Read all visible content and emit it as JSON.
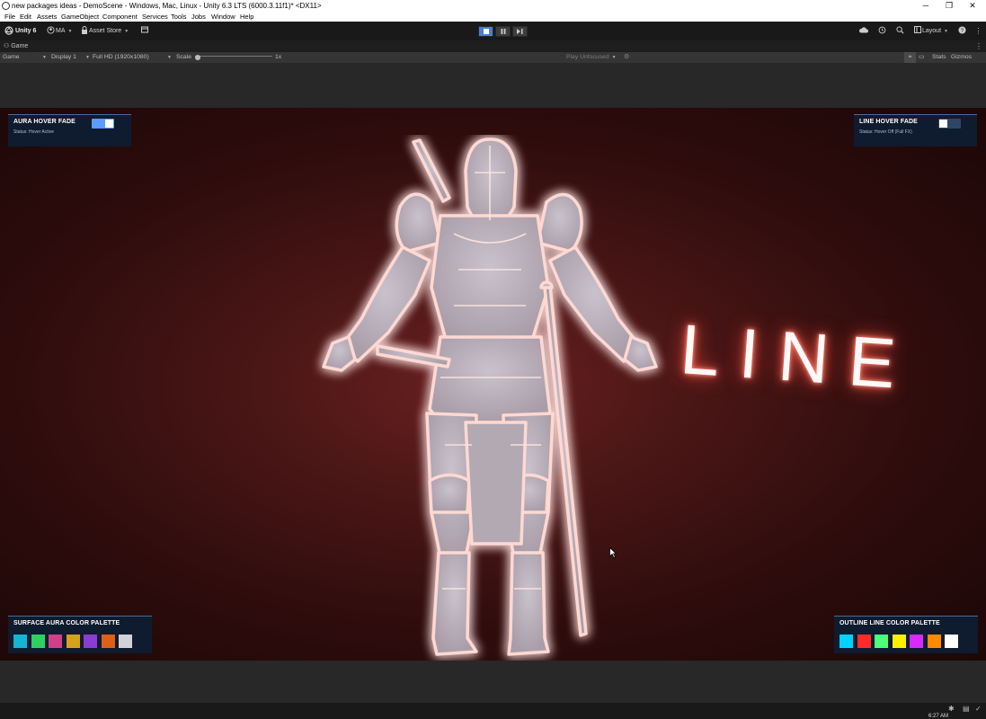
{
  "window": {
    "title": "new packages ideas - DemoScene - Windows, Mac, Linux - Unity 6.3 LTS (6000.3.11f1)* <DX11>",
    "controls": [
      "─",
      "❐",
      "✕"
    ]
  },
  "menu": [
    "File",
    "Edit",
    "Assets",
    "GameObject",
    "Component",
    "Services",
    "Tools",
    "Jobs",
    "Window",
    "Help"
  ],
  "toolbar": {
    "unity_label": "Unity 6",
    "account_label": "MA",
    "asset_store_label": "Asset Store",
    "layout_label": "Layout"
  },
  "tab": {
    "label": "Game"
  },
  "gamebar": {
    "view_select": "Game",
    "display_select": "Display 1",
    "resolution_select": "Full HD (1920x1080)",
    "scale_label": "Scale",
    "scale_value": "1x",
    "play_focus": "Play Unfocused",
    "stats_label": "Stats",
    "gizmos_label": "Gizmos"
  },
  "scene": {
    "line_text": "LINE"
  },
  "aura_panel": {
    "title": "AURA HOVER FADE",
    "status": "Status: Hover Active",
    "toggle_on": true
  },
  "line_panel": {
    "title": "LINE HOVER FADE",
    "status": "Status: Hover Off (Full FX)",
    "toggle_on": false
  },
  "surface_palette": {
    "title": "SURFACE AURA COLOR PALETTE",
    "colors": [
      "#14b4d2",
      "#2ed062",
      "#d0408a",
      "#d6a21e",
      "#8c3cd0",
      "#de5f1a",
      "#d2d2d6"
    ]
  },
  "outline_palette": {
    "title": "OUTLINE LINE COLOR PALETTE",
    "colors": [
      "#00d2ff",
      "#ff2a2a",
      "#4aff7a",
      "#ffee00",
      "#d62aff",
      "#ff8a00",
      "#ffffff"
    ]
  },
  "status": {
    "time": "6:27 AM"
  }
}
